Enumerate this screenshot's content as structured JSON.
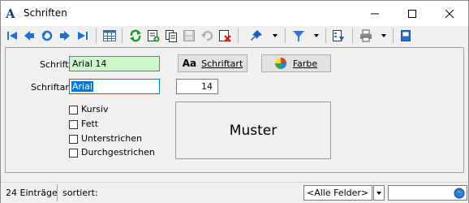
{
  "window": {
    "title": "Schriften",
    "icon": "A"
  },
  "toolbar": {
    "icons": [
      "first-record-icon",
      "previous-record-icon",
      "undo-icon",
      "next-record-icon",
      "last-record-icon",
      "table-view-icon",
      "refresh-icon",
      "new-record-icon",
      "copy-record-icon",
      "save-icon",
      "undo-changes-icon",
      "delete-icon",
      "pin-icon",
      "filter-icon",
      "export-icon",
      "print-icon",
      "settings-icon"
    ]
  },
  "form": {
    "schrift_label": "Schrift",
    "schrift_value": "Arial 14",
    "schriftart_label": "Schriftart",
    "schriftart_value": "Arial",
    "size_value": "14",
    "schriftart_button": "Schriftart",
    "schriftart_button_icon": "Aa",
    "farbe_button": "Farbe",
    "checkboxes": [
      {
        "label": "Kursiv",
        "checked": false
      },
      {
        "label": "Fett",
        "checked": false
      },
      {
        "label": "Unterstrichen",
        "checked": false
      },
      {
        "label": "Durchgestrichen",
        "checked": false
      }
    ],
    "muster": "Muster"
  },
  "status": {
    "count": "24 Einträge",
    "sorted": "sortiert:",
    "field_select": "<Alle Felder>"
  }
}
